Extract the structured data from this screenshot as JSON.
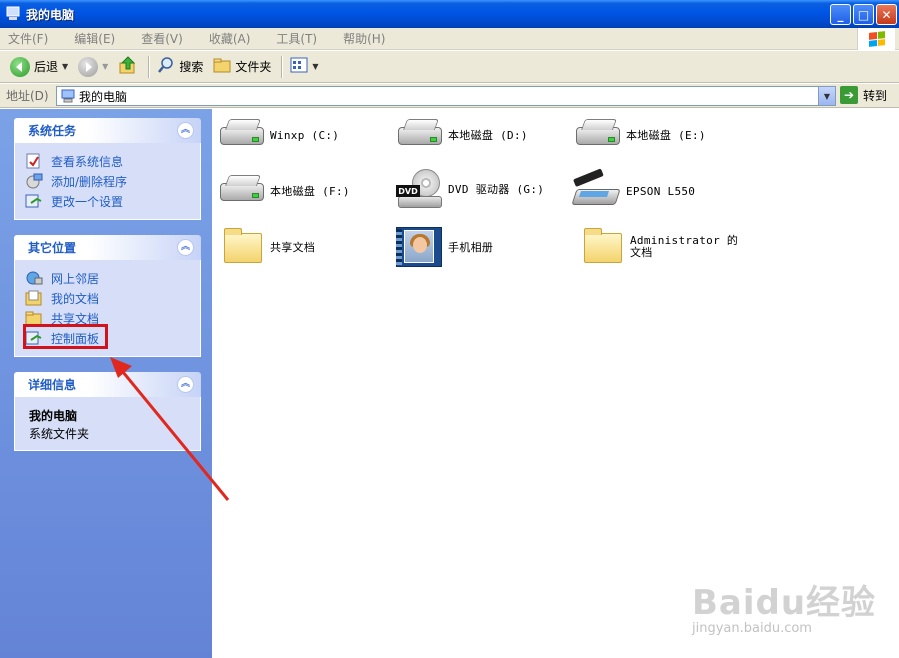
{
  "window": {
    "title": "我的电脑",
    "controls": {
      "minimize": "_",
      "maximize": "□",
      "close": "✕"
    }
  },
  "menu": [
    "文件(F)",
    "编辑(E)",
    "查看(V)",
    "收藏(A)",
    "工具(T)",
    "帮助(H)"
  ],
  "toolbar": {
    "back": "后退",
    "search": "搜索",
    "folders": "文件夹"
  },
  "address": {
    "label": "地址(D)",
    "value": "我的电脑",
    "go": "转到"
  },
  "panels": {
    "system_tasks": {
      "title": "系统任务",
      "items": [
        "查看系统信息",
        "添加/删除程序",
        "更改一个设置"
      ]
    },
    "other_places": {
      "title": "其它位置",
      "items": [
        "网上邻居",
        "我的文档",
        "共享文档",
        "控制面板"
      ]
    },
    "details": {
      "title": "详细信息",
      "name": "我的电脑",
      "type": "系统文件夹"
    }
  },
  "items": [
    {
      "label": "Winxp (C:)",
      "icon": "hard-drive-icon"
    },
    {
      "label": "本地磁盘 (D:)",
      "icon": "hard-drive-icon"
    },
    {
      "label": "本地磁盘 (E:)",
      "icon": "hard-drive-icon"
    },
    {
      "label": "本地磁盘 (F:)",
      "icon": "hard-drive-icon"
    },
    {
      "label": "DVD 驱动器 (G:)",
      "icon": "dvd-drive-icon"
    },
    {
      "label": "EPSON L550",
      "icon": "scanner-icon"
    },
    {
      "label": "共享文档",
      "icon": "folder-icon"
    },
    {
      "label": "手机相册",
      "icon": "photo-album-icon"
    },
    {
      "label": "Administrator 的文档",
      "icon": "folder-icon"
    }
  ],
  "watermark": {
    "brand": "Baidu经验",
    "site": "jingyan.baidu.com"
  },
  "colors": {
    "titlebar": "#0055e5",
    "taskpane": "#6f93df",
    "link": "#215dc6",
    "highlight": "#d2131b"
  }
}
